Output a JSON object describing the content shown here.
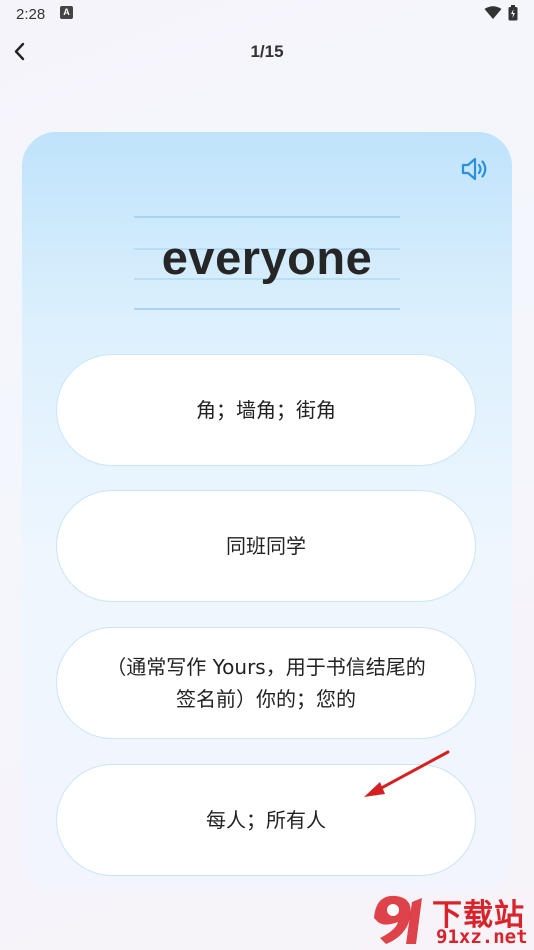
{
  "status_bar": {
    "time": "2:28",
    "notification_icon": "A"
  },
  "header": {
    "progress": "1/15"
  },
  "card": {
    "word": "everyone",
    "options": [
      {
        "text": "角；墙角；街角"
      },
      {
        "text": "同班同学"
      },
      {
        "text": "（通常写作 Yours，用于书信结尾的签名前）你的；您的"
      },
      {
        "text": "每人；所有人"
      }
    ]
  },
  "watermark": {
    "brand": "下载站",
    "domain": "91xz.net"
  },
  "colors": {
    "accent": "#2a8fdc",
    "arrow": "#d42020",
    "watermark": "#d8232a"
  }
}
